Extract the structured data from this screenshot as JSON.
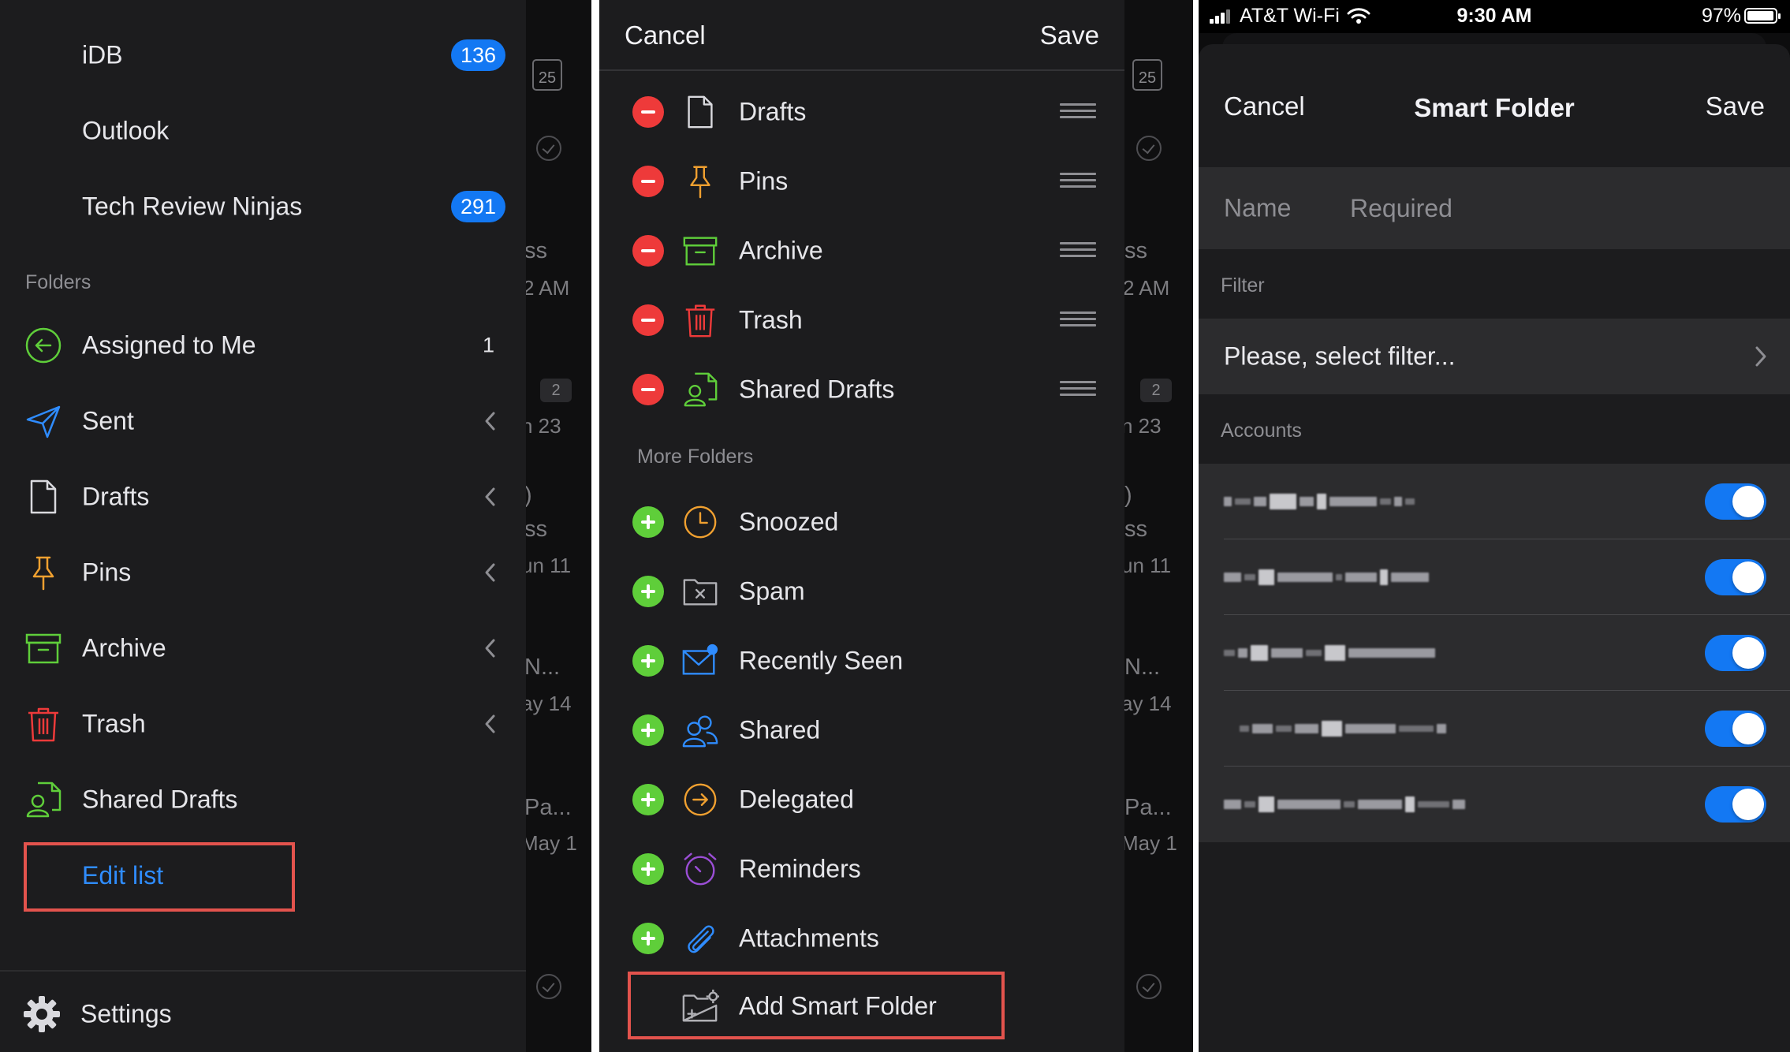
{
  "panel1": {
    "background_text": [
      {
        "text": "ss"
      },
      {
        "text": "2 AM"
      },
      {
        "text": "n 23"
      },
      {
        "text": ")"
      },
      {
        "text": "ss"
      },
      {
        "text": "un 11"
      },
      {
        "text": "N..."
      },
      {
        "text": "ay 14"
      },
      {
        "text": "Pa..."
      },
      {
        "text": "May 1"
      }
    ],
    "background_calendar_day": "25",
    "background_count": "2",
    "accounts": [
      {
        "name": "iDB",
        "badge": "136"
      },
      {
        "name": "Outlook",
        "badge": ""
      },
      {
        "name": "Tech Review Ninjas",
        "badge": "291"
      }
    ],
    "folders_label": "Folders",
    "folders": [
      {
        "name": "Assigned to Me",
        "icon": "assigned-icon",
        "count": "1",
        "color": "#5fce3a"
      },
      {
        "name": "Sent",
        "icon": "sent-icon",
        "count": "",
        "color": "#2f8cff"
      },
      {
        "name": "Drafts",
        "icon": "drafts-icon",
        "count": "",
        "color": "#e6e6ea"
      },
      {
        "name": "Pins",
        "icon": "pin-icon",
        "count": "",
        "color": "#f0a030"
      },
      {
        "name": "Archive",
        "icon": "archive-icon",
        "count": "",
        "color": "#5fce3a"
      },
      {
        "name": "Trash",
        "icon": "trash-icon",
        "count": "",
        "color": "#ee3a3a"
      },
      {
        "name": "Shared Drafts",
        "icon": "shared-drafts-icon",
        "count": "",
        "color": "#5fce3a"
      }
    ],
    "edit_list_label": "Edit list",
    "settings_label": "Settings"
  },
  "panel2": {
    "cancel_label": "Cancel",
    "save_label": "Save",
    "current_folders": [
      {
        "name": "Drafts",
        "icon": "drafts-icon"
      },
      {
        "name": "Pins",
        "icon": "pin-icon"
      },
      {
        "name": "Archive",
        "icon": "archive-icon"
      },
      {
        "name": "Trash",
        "icon": "trash-icon"
      },
      {
        "name": "Shared Drafts",
        "icon": "shared-drafts-icon"
      }
    ],
    "more_folders_label": "More Folders",
    "more_folders": [
      {
        "name": "Snoozed",
        "icon": "clock-icon"
      },
      {
        "name": "Spam",
        "icon": "spam-icon"
      },
      {
        "name": "Recently Seen",
        "icon": "recently-seen-icon"
      },
      {
        "name": "Shared",
        "icon": "shared-icon"
      },
      {
        "name": "Delegated",
        "icon": "delegated-icon"
      },
      {
        "name": "Reminders",
        "icon": "alarm-icon"
      },
      {
        "name": "Attachments",
        "icon": "paperclip-icon"
      }
    ],
    "add_smart_folder_label": "Add Smart Folder"
  },
  "panel3": {
    "status": {
      "carrier": "AT&T Wi-Fi",
      "time": "9:30 AM",
      "battery": "97%"
    },
    "cancel_label": "Cancel",
    "title": "Smart Folder",
    "save_label": "Save",
    "name_label": "Name",
    "name_placeholder": "Required",
    "filter_label": "Filter",
    "filter_value": "Please, select filter...",
    "accounts_label": "Accounts",
    "accounts": [
      {
        "enabled": true
      },
      {
        "enabled": true
      },
      {
        "enabled": true
      },
      {
        "enabled": true
      },
      {
        "enabled": true
      }
    ]
  },
  "colors": {
    "accent_blue": "#1378f3",
    "link_blue": "#2f8cff",
    "remove_red": "#ee3a3a",
    "add_green": "#5fce3a",
    "highlight_box": "#e3534d",
    "background": "#1c1c1e"
  }
}
